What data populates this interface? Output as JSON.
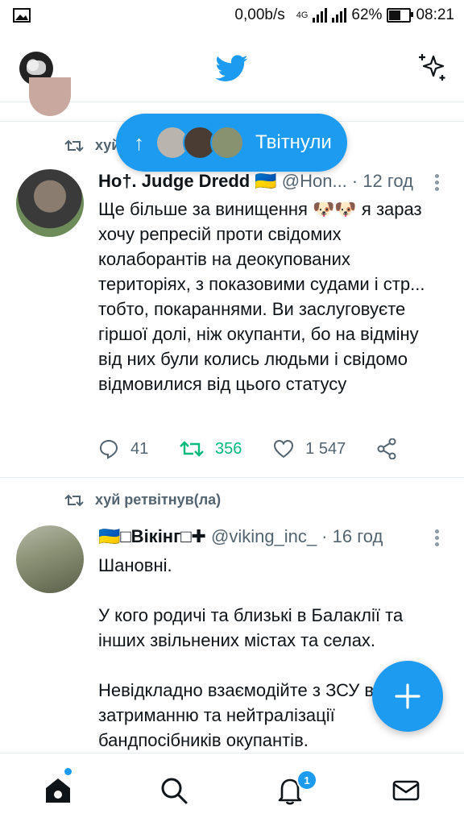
{
  "status_bar": {
    "network_speed": "0,00b/s",
    "network_type": "4G",
    "battery_percent": "62%",
    "battery_level": 0.62,
    "time": "08:21"
  },
  "header": {
    "logo_icon": "twitter-bird-icon",
    "brand_color": "#1d9bf0"
  },
  "new_tweets_pill": {
    "label": "Твітнули"
  },
  "tweets": [
    {
      "retweeted_by": "хуй",
      "name": "Но†. Judge Dredd 🇺🇦",
      "handle": "@Hon...",
      "time": "· 12 год",
      "text": "Ще більше за винищення 🐶🐶 я зараз хочу репресій проти свідомих колаборантів на деокупованих територіях, з показовими судами і стр... тобто, покараннями. Ви заслуговуєте гіршої долі, ніж окупанти, бо на відміну від них були колись людьми і свідомо відмовилися від цього статусу",
      "replies": "41",
      "retweets": "356",
      "likes": "1 547"
    },
    {
      "retweeted_by": "хуй ретвітнув(ла)",
      "name": "🇺🇦□Вікінг□✚",
      "handle": "@viking_inc_",
      "time": "· 16 год",
      "text": "Шановні.\n\nУ кого родичі та близькі в Балаклії та інших звільнених містах та селах.\n\nНевідкладно взаємодійте з ЗСУ в затриманню та нейтралізації бандпосібників окупантів."
    }
  ],
  "bottom_nav": {
    "notifications_badge": "1"
  }
}
